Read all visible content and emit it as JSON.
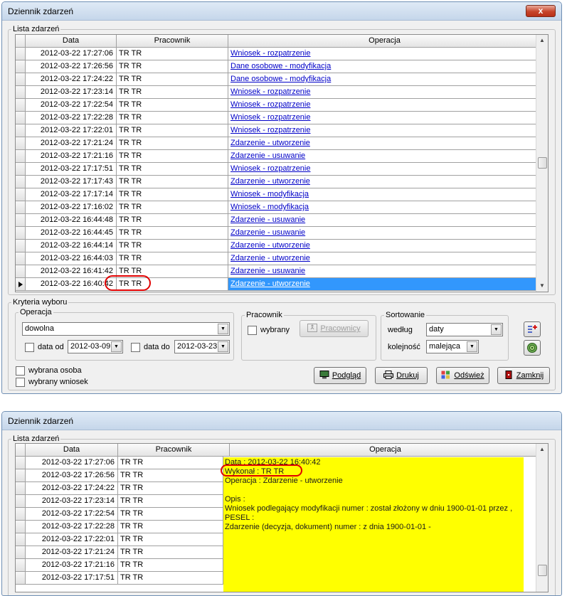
{
  "window1": {
    "title": "Dziennik zdarzeń",
    "close_label": "x",
    "list_group": "Lista zdarzeń",
    "columns": [
      "Data",
      "Pracownik",
      "Operacja"
    ],
    "rows": [
      {
        "date": "2012-03-22 17:27:06",
        "emp": "TR TR",
        "op": "Wniosek - rozpatrzenie"
      },
      {
        "date": "2012-03-22 17:26:56",
        "emp": "TR TR",
        "op": "Dane osobowe - modyfikacja"
      },
      {
        "date": "2012-03-22 17:24:22",
        "emp": "TR TR",
        "op": "Dane osobowe - modyfikacja"
      },
      {
        "date": "2012-03-22 17:23:14",
        "emp": "TR TR",
        "op": "Wniosek - rozpatrzenie"
      },
      {
        "date": "2012-03-22 17:22:54",
        "emp": "TR TR",
        "op": "Wniosek - rozpatrzenie"
      },
      {
        "date": "2012-03-22 17:22:28",
        "emp": "TR TR",
        "op": "Wniosek - rozpatrzenie"
      },
      {
        "date": "2012-03-22 17:22:01",
        "emp": "TR TR",
        "op": "Wniosek - rozpatrzenie"
      },
      {
        "date": "2012-03-22 17:21:24",
        "emp": "TR TR",
        "op": "Zdarzenie - utworzenie"
      },
      {
        "date": "2012-03-22 17:21:16",
        "emp": "TR TR",
        "op": "Zdarzenie - usuwanie"
      },
      {
        "date": "2012-03-22 17:17:51",
        "emp": "TR TR",
        "op": "Wniosek - rozpatrzenie"
      },
      {
        "date": "2012-03-22 17:17:43",
        "emp": "TR TR",
        "op": "Zdarzenie - utworzenie"
      },
      {
        "date": "2012-03-22 17:17:14",
        "emp": "TR TR",
        "op": "Wniosek - modyfikacja"
      },
      {
        "date": "2012-03-22 17:16:02",
        "emp": "TR TR",
        "op": "Wniosek - modyfikacja"
      },
      {
        "date": "2012-03-22 16:44:48",
        "emp": "TR TR",
        "op": "Zdarzenie - usuwanie"
      },
      {
        "date": "2012-03-22 16:44:45",
        "emp": "TR TR",
        "op": "Zdarzenie - usuwanie"
      },
      {
        "date": "2012-03-22 16:44:14",
        "emp": "TR TR",
        "op": "Zdarzenie - utworzenie"
      },
      {
        "date": "2012-03-22 16:44:03",
        "emp": "TR TR",
        "op": "Zdarzenie - utworzenie"
      },
      {
        "date": "2012-03-22 16:41:42",
        "emp": "TR TR",
        "op": "Zdarzenie - usuwanie"
      },
      {
        "date": "2012-03-22 16:40:42",
        "emp": "TR TR",
        "op": "Zdarzenie - utworzenie"
      }
    ],
    "selected_index": 18,
    "criteria_group": "Kryteria wyboru",
    "operation_group": "Operacja",
    "operation_value": "dowolna",
    "date_from_label": "data od",
    "date_from_value": "2012-03-09",
    "date_to_label": "data do",
    "date_to_value": "2012-03-23",
    "employee_group": "Pracownik",
    "selected_label": "wybrany",
    "employees_button": "Pracownicy",
    "sort_group": "Sortowanie",
    "sort_by_label": "według",
    "sort_by_value": "daty",
    "order_label": "kolejność",
    "order_value": "malejąca",
    "chosen_person_label": "wybrana osoba",
    "chosen_request_label": "wybrany wniosek",
    "buttons": {
      "preview": "Podgląd",
      "print": "Drukuj",
      "refresh": "Odśwież",
      "close": "Zamknij"
    }
  },
  "window2": {
    "title": "Dziennik zdarzeń",
    "list_group": "Lista zdarzeń",
    "columns": [
      "Data",
      "Pracownik",
      "Operacja"
    ],
    "rows": [
      {
        "date": "2012-03-22 17:27:06",
        "emp": "TR TR"
      },
      {
        "date": "2012-03-22 17:26:56",
        "emp": "TR TR"
      },
      {
        "date": "2012-03-22 17:24:22",
        "emp": "TR TR"
      },
      {
        "date": "2012-03-22 17:23:14",
        "emp": "TR TR"
      },
      {
        "date": "2012-03-22 17:22:54",
        "emp": "TR TR"
      },
      {
        "date": "2012-03-22 17:22:28",
        "emp": "TR TR"
      },
      {
        "date": "2012-03-22 17:22:01",
        "emp": "TR TR"
      },
      {
        "date": "2012-03-22 17:21:24",
        "emp": "TR TR"
      },
      {
        "date": "2012-03-22 17:21:16",
        "emp": "TR TR"
      },
      {
        "date": "2012-03-22 17:17:51",
        "emp": "TR TR"
      }
    ],
    "details": [
      "Data : 2012-03-22 16:40:42",
      "Wykonał : TR TR",
      "Operacja : Zdarzenie - utworzenie",
      "",
      "Opis :",
      "Wniosek podlegający modyfikacji numer :  został złożony w dniu 1900-01-01 przez  ,",
      "PESEL :",
      "Zdarzenie (decyzja, dokument) numer :  z dnia 1900-01-01 -"
    ]
  },
  "colors": {
    "highlight": "#e00000",
    "selection": "#3297fd",
    "detail_bg": "#ffff00",
    "link": "#0000c8"
  }
}
